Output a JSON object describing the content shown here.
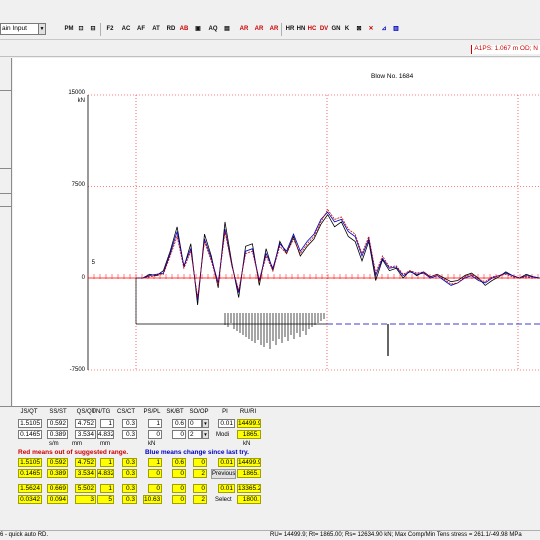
{
  "toolbar": {
    "combo_value": "ain Input",
    "buttons": [
      "PM",
      "F2",
      "AC",
      "AF",
      "AT",
      "RD",
      "AB",
      "AQ",
      "AR",
      "AR",
      "AR",
      "HR",
      "HN",
      "HC",
      "DV",
      "GN",
      "K"
    ]
  },
  "status_top": {
    "message": "A1PS: 1.067 m OD; N"
  },
  "plot": {
    "title": "Blow No. 1684",
    "y_unit": "kN",
    "y_ticks": [
      "15000",
      "7500",
      "5",
      "0",
      "-7500"
    ]
  },
  "chart_data": {
    "type": "line",
    "title": "Blow No. 1684",
    "ylabel": "kN",
    "ylim": [
      -7500,
      15000
    ],
    "y_ticks": [
      15000,
      7500,
      0,
      -7500
    ],
    "series": [
      {
        "color": "#000000",
        "values": [
          0,
          0,
          300,
          200,
          600,
          2200,
          4200,
          900,
          2800,
          -2200,
          3600,
          1800,
          -800,
          4600,
          1200,
          -1600,
          2600,
          2800,
          -600,
          2400,
          600,
          3000,
          2000,
          3400,
          1800,
          2600,
          3200,
          4400,
          5200,
          4200,
          4600,
          3400,
          3000,
          1400,
          3000,
          -200,
          1500,
          600,
          800,
          0,
          600,
          200,
          500,
          100,
          300,
          0,
          -300,
          -200,
          200,
          400,
          0,
          -600,
          -200,
          100,
          500,
          200,
          0,
          300,
          100,
          0
        ]
      },
      {
        "color": "#0000c0",
        "values": [
          0,
          0,
          200,
          300,
          400,
          2000,
          3800,
          1000,
          2400,
          -1800,
          3200,
          1600,
          -400,
          4000,
          1000,
          -1200,
          2200,
          2400,
          -200,
          2000,
          800,
          2800,
          2200,
          3600,
          2200,
          3000,
          3600,
          4800,
          5400,
          4600,
          4800,
          3800,
          3400,
          1800,
          3200,
          200,
          1600,
          800,
          900,
          200,
          500,
          300,
          400,
          0,
          200,
          -200,
          -600,
          -400,
          0,
          200,
          -200,
          -400,
          0,
          200,
          400,
          200,
          0,
          200,
          100,
          0
        ]
      },
      {
        "color": "#c00000",
        "values": [
          0,
          0,
          100,
          200,
          300,
          1800,
          3400,
          800,
          2200,
          -1600,
          3000,
          1400,
          -600,
          3800,
          1000,
          -1000,
          2000,
          2200,
          -300,
          1800,
          600,
          2600,
          2000,
          3200,
          2000,
          2800,
          3400,
          4600,
          5600,
          4800,
          5000,
          4000,
          3600,
          2000,
          3400,
          400,
          1800,
          900,
          1000,
          300,
          600,
          400,
          500,
          100,
          300,
          -100,
          -500,
          -400,
          100,
          300,
          -100,
          -300,
          100,
          200,
          300,
          100,
          0,
          100,
          0,
          0
        ]
      }
    ]
  },
  "table": {
    "headers": [
      "JS/QT",
      "SS/ST",
      "QS/QT",
      "UN/TG",
      "CS/CT",
      "PS/PL",
      "SK/BT",
      "SO/OP",
      "PI",
      "RU/RI"
    ],
    "row1": [
      "1.5105",
      "0.592",
      "4.752",
      "1",
      "0.3",
      "1",
      "0.6",
      "0",
      "0.01",
      "14499.9"
    ],
    "row2": [
      "0.1465",
      "0.389",
      "3.534",
      "4.832",
      "0.3",
      "0",
      "0",
      "2",
      "Modi",
      "1865."
    ],
    "units": [
      "s/m",
      "mm",
      "mm",
      "kN",
      "kN"
    ],
    "note_red": "Red means out of suggested range.",
    "note_blue": "Blue means change since last try.",
    "row3": [
      "1.5105",
      "0.592",
      "4.752",
      "1",
      "0.3",
      "1",
      "0.6",
      "0",
      "0.01",
      "14499.9"
    ],
    "row4": [
      "0.1465",
      "0.389",
      "3.534",
      "4.832",
      "0.3",
      "0",
      "0",
      "2",
      "Previous",
      "1865."
    ],
    "row5": [
      "1.5624",
      "0.669",
      "5.502",
      "1",
      "0.3",
      "0",
      "0",
      "0",
      "0.01",
      "13365.2"
    ],
    "row6": [
      "0.0342",
      "0.094",
      "3",
      "5",
      "0.3",
      "10.63",
      "0",
      "2",
      "Select",
      "1800."
    ]
  },
  "status_bottom": {
    "left": "6 - quick auto RD.",
    "right": "RU= 14499.9; Rt= 1865.00; Rs= 12634.90 kN; Max Comp/Min Tens stress = 261.1/-49.98 MPa"
  },
  "colors": {
    "highlight": "#ffff00",
    "grid_red": "#ff0000",
    "wave_black": "#000000",
    "wave_blue": "#0000c0",
    "wave_red": "#c00000"
  }
}
